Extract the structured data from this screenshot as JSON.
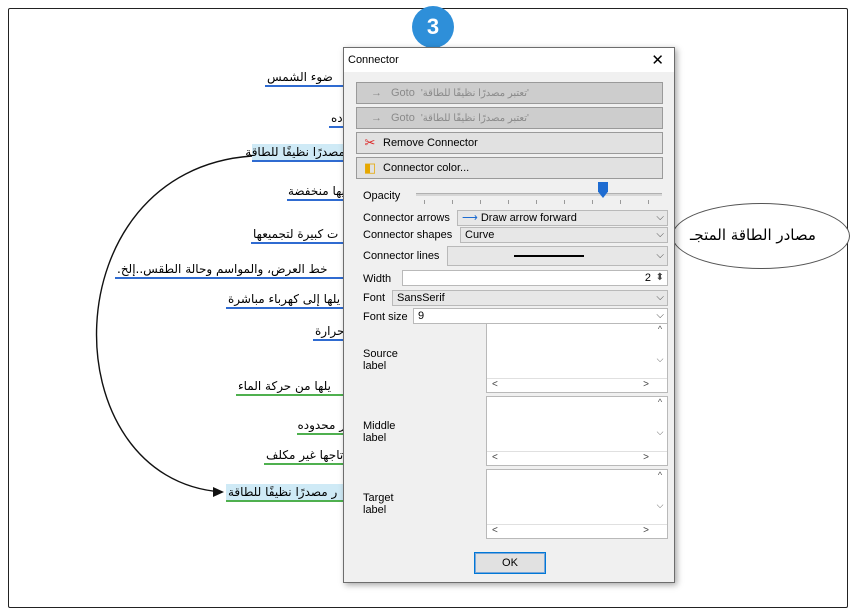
{
  "step_number": "3",
  "mindmap": {
    "central_topic": "مصادر الطاقة المتجـ",
    "nodes": [
      {
        "text": "ضوء الشمس",
        "color": "blue",
        "highlight": false
      },
      {
        "text": "ده",
        "color": "blue",
        "highlight": false
      },
      {
        "text": "مصدرًا نظيفًا للطاقة",
        "color": "blue",
        "highlight": true
      },
      {
        "text": "يها منخفضة",
        "color": "blue",
        "highlight": false
      },
      {
        "text": "ت كبيرة لتجميعها",
        "color": "blue",
        "highlight": false
      },
      {
        "text": "خط العرض، والمواسم وحالة الطقس..إلخ.",
        "color": "blue",
        "highlight": false
      },
      {
        "text": "يلها إلى كهرباء مباشرة",
        "color": "blue",
        "highlight": false
      },
      {
        "text": "حرارة",
        "color": "blue",
        "highlight": false
      },
      {
        "text": "يلها من حركة الماء",
        "color": "green",
        "highlight": false
      },
      {
        "text": "ر محدوده",
        "color": "green",
        "highlight": false
      },
      {
        "text": "تاجها غير مكلف",
        "color": "green",
        "highlight": false
      },
      {
        "text": "ر مصدرًا نظيفًا للطاقة",
        "color": "green",
        "highlight": true
      }
    ]
  },
  "dialog": {
    "title": "Connector",
    "goto_1": {
      "label": "Goto",
      "text": "'تعتبر مصدرًا نظيفًا للطاقة'"
    },
    "goto_2": {
      "label": "Goto",
      "text": "'تعتبر مصدرًا نظيفًا للطاقة'"
    },
    "remove_label": "Remove Connector",
    "color_label": "Connector color...",
    "opacity_label": "Opacity",
    "opacity_value": 0.8,
    "arrows_label": "Connector arrows",
    "arrows_value": "Draw arrow forward",
    "shapes_label": "Connector shapes",
    "shapes_value": "Curve",
    "lines_label": "Connector lines",
    "width_label": "Width",
    "width_value": "2",
    "font_label": "Font",
    "font_value": "SansSerif",
    "font_size_label": "Font size",
    "font_size_value": "9",
    "source_label": "Source\nlabel",
    "middle_label": "Middle\nlabel",
    "target_label": "Target\nlabel",
    "ok_label": "OK"
  },
  "icons": {
    "goto_arrow": "right-arrow-icon",
    "remove": "scissors-connector-icon",
    "color": "color-palette-icon"
  },
  "colors": {
    "blue_underline": "#2f6bd1",
    "green_underline": "#4fb04f",
    "highlight": "#cfeaf6",
    "badge": "#2e8fd9",
    "accent": "#1e6cd1"
  }
}
